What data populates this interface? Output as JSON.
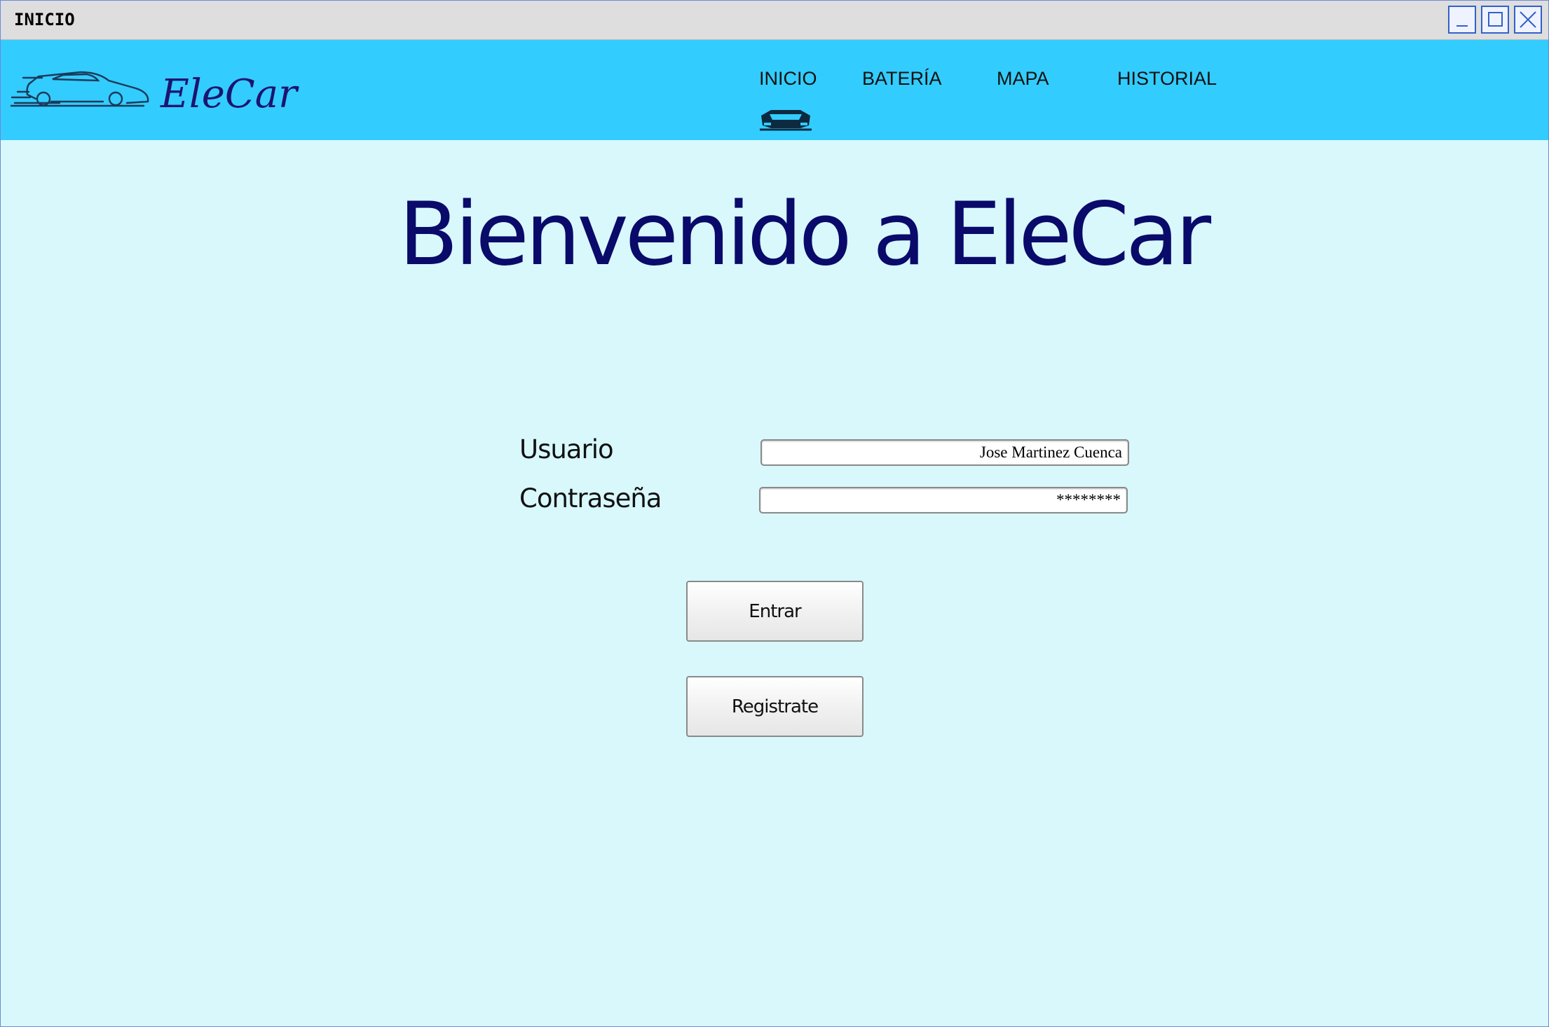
{
  "window": {
    "title": "INICIO",
    "controls": {
      "minimize_icon": "minimize-icon",
      "maximize_icon": "maximize-icon",
      "close_icon": "close-icon"
    }
  },
  "navbar": {
    "brand": "EleCar",
    "brand_icon": "car-logo-icon",
    "items": [
      {
        "label": "INICIO",
        "active": true
      },
      {
        "label": "BATERÍA"
      },
      {
        "label": "MAPA"
      },
      {
        "label": "HISTORIAL"
      }
    ],
    "active_indicator_icon": "car-front-icon",
    "background": "#33ccff"
  },
  "main": {
    "welcome": "Bienvenido a EleCar",
    "form": {
      "username_label": "Usuario",
      "username_value": "Jose Martinez Cuenca",
      "password_label": "Contraseña",
      "password_value": "********"
    },
    "buttons": {
      "login": "Entrar",
      "register": "Registrate"
    },
    "background": "#d8f8fc"
  }
}
